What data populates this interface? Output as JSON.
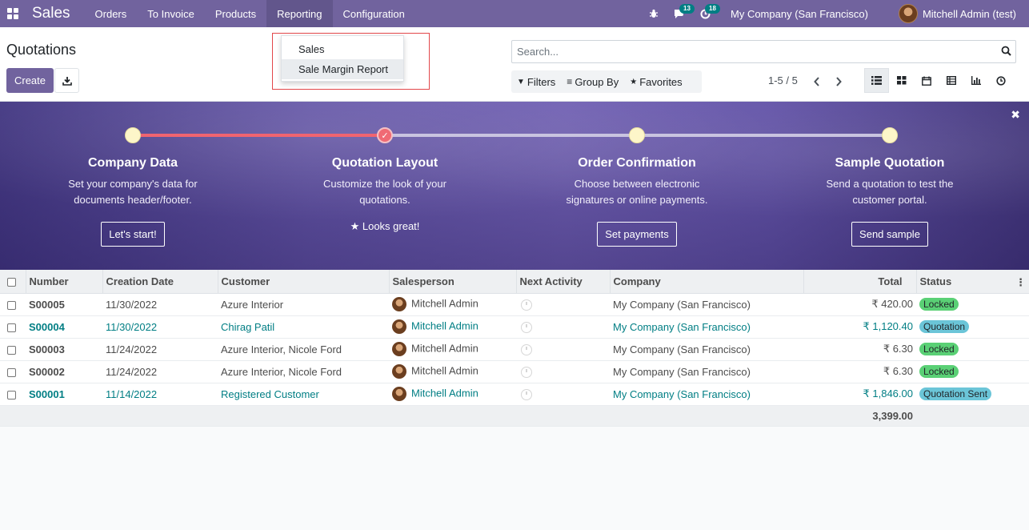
{
  "navbar": {
    "app_name": "Sales",
    "menu": [
      "Orders",
      "To Invoice",
      "Products",
      "Reporting",
      "Configuration"
    ],
    "messages_count": "13",
    "activities_count": "18",
    "company": "My Company (San Francisco)",
    "user": "Mitchell Admin (test)"
  },
  "reporting_dropdown": {
    "items": [
      "Sales",
      "Sale Margin Report"
    ]
  },
  "control_panel": {
    "title": "Quotations",
    "create_label": "Create",
    "search_placeholder": "Search...",
    "filters_label": "Filters",
    "groupby_label": "Group By",
    "favorites_label": "Favorites",
    "pager": "1-5 / 5"
  },
  "onboarding": {
    "steps": [
      {
        "title": "Company Data",
        "desc1": "Set your company's data for",
        "desc2": "documents header/footer.",
        "button": "Let's start!"
      },
      {
        "title": "Quotation Layout",
        "desc1": "Customize the look of your",
        "desc2": "quotations.",
        "done": "Looks great!"
      },
      {
        "title": "Order Confirmation",
        "desc1": "Choose between electronic",
        "desc2": "signatures or online payments.",
        "button": "Set payments"
      },
      {
        "title": "Sample Quotation",
        "desc1": "Send a quotation to test the",
        "desc2": "customer portal.",
        "button": "Send sample"
      }
    ]
  },
  "table": {
    "columns": [
      "Number",
      "Creation Date",
      "Customer",
      "Salesperson",
      "Next Activity",
      "Company",
      "Total",
      "Status"
    ],
    "rows": [
      {
        "number": "S00005",
        "date": "11/30/2022",
        "customer": "Azure Interior",
        "salesperson": "Mitchell Admin",
        "company": "My Company (San Francisco)",
        "total": "₹ 420.00",
        "status": "Locked"
      },
      {
        "number": "S00004",
        "date": "11/30/2022",
        "customer": "Chirag Patil",
        "salesperson": "Mitchell Admin",
        "company": "My Company (San Francisco)",
        "total": "₹ 1,120.40",
        "status": "Quotation"
      },
      {
        "number": "S00003",
        "date": "11/24/2022",
        "customer": "Azure Interior, Nicole Ford",
        "salesperson": "Mitchell Admin",
        "company": "My Company (San Francisco)",
        "total": "₹ 6.30",
        "status": "Locked"
      },
      {
        "number": "S00002",
        "date": "11/24/2022",
        "customer": "Azure Interior, Nicole Ford",
        "salesperson": "Mitchell Admin",
        "company": "My Company (San Francisco)",
        "total": "₹ 6.30",
        "status": "Locked"
      },
      {
        "number": "S00001",
        "date": "11/14/2022",
        "customer": "Registered Customer",
        "salesperson": "Mitchell Admin",
        "company": "My Company (San Francisco)",
        "total": "₹ 1,846.00",
        "status": "Quotation Sent"
      }
    ],
    "sum_total": "3,399.00"
  },
  "colors": {
    "brand": "#71639e",
    "link": "#017e84",
    "locked": "#5ad075",
    "quotation": "#6bc5d8",
    "highlight_box": "#e2474a"
  }
}
